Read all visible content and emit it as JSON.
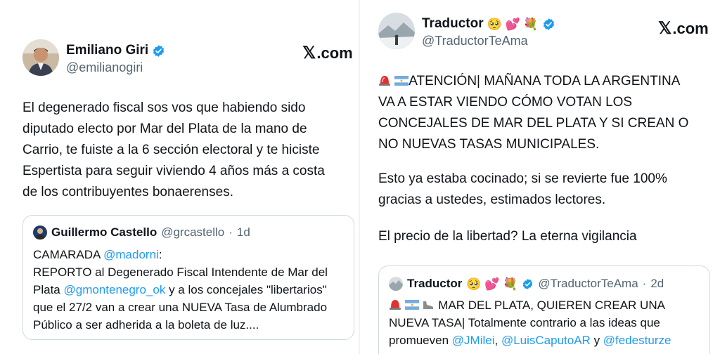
{
  "left_tweet": {
    "author_name": "Emiliano Giri",
    "author_handle": "@emilianogiri",
    "brand": ".com",
    "body_lines": [
      "El degenerado fiscal sos vos que habiendo sido",
      "diputado electo por Mar del Plata de la mano de",
      "Carrio, te fuiste a la 6 sección electoral y te hiciste",
      "Espertista para seguir viviendo 4 años más a costa",
      "de los contribuyentes bonaerenses."
    ],
    "quote": {
      "author_name": "Guillermo Castello",
      "author_handle": "@grcastello",
      "separator": "·",
      "time": "1d",
      "line1_prefix": "CAMARADA ",
      "line1_mention": "@madorni",
      "line1_suffix": ":",
      "line2": "REPORTO al Degenerado Fiscal Intendente de Mar del",
      "line3_prefix": "Plata ",
      "line3_mention": "@gmontenegro_ok",
      "line3_suffix": " y a los concejales \"libertarios\"",
      "line4": "que el 27/2 van a crear una NUEVA Tasa de Alumbrado",
      "line5": "Público a ser adherida a la boleta de luz...."
    }
  },
  "right_tweet": {
    "author_name": "Traductor",
    "author_emojis": "🥺 💕 💐",
    "author_handle": "@TraductorTeAma",
    "brand": ".com",
    "alert_lines": [
      "ATENCIÓN| MAÑANA TODA LA ARGENTINA",
      "VA A ESTAR VIENDO CÓMO VOTAN LOS",
      "CONCEJALES DE MAR DEL PLATA Y SI CREAN O",
      "NO NUEVAS TASAS MUNICIPALES."
    ],
    "para2_lines": [
      "Esto ya estaba cocinado; si se revierte fue 100%",
      "gracias a ustedes, estimados lectores."
    ],
    "para3": "El precio de la libertad? La eterna vigilancia",
    "quote": {
      "author_name": "Traductor",
      "author_emojis": "🥺 💕 💐",
      "author_handle": "@TraductorTeAma",
      "separator": "·",
      "time": "2d",
      "line1": "MAR DEL PLATA, QUIEREN CREAR UNA",
      "line2": "NUEVA TASA| Totalmente contrario a las ideas que",
      "line3_prefix": "promueven ",
      "mention1": "@JMilei",
      "sep1": ", ",
      "mention2": "@LuisCaputoAR",
      "sep2": " y ",
      "mention3": "@fedesturze"
    }
  },
  "colors": {
    "mention": "#1d9bf0",
    "verified": "#1d9bf0",
    "secondary_text": "#536471",
    "quote_border": "#cfd9de"
  }
}
